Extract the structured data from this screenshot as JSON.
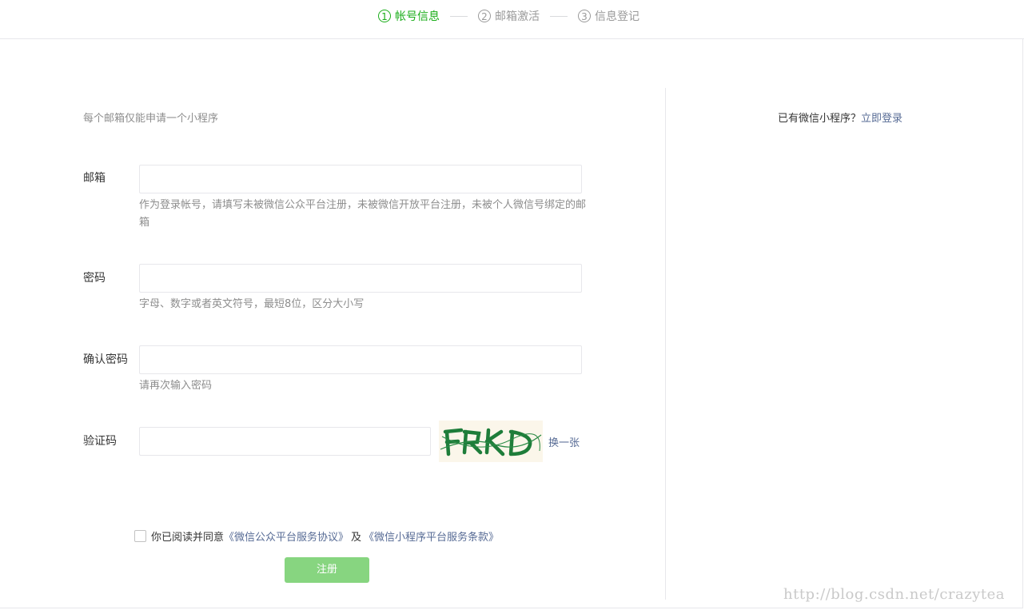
{
  "steps": [
    {
      "num": "1",
      "label": "帐号信息",
      "active": true
    },
    {
      "num": "2",
      "label": "邮箱激活",
      "active": false
    },
    {
      "num": "3",
      "label": "信息登记",
      "active": false
    }
  ],
  "form": {
    "tips": "每个邮箱仅能申请一个小程序",
    "email": {
      "label": "邮箱",
      "value": "",
      "hint": "作为登录帐号，请填写未被微信公众平台注册，未被微信开放平台注册，未被个人微信号绑定的邮箱"
    },
    "password": {
      "label": "密码",
      "value": "",
      "hint": "字母、数字或者英文符号，最短8位，区分大小写"
    },
    "confirm_password": {
      "label": "确认密码",
      "value": "",
      "hint": "请再次输入密码"
    },
    "captcha": {
      "label": "验证码",
      "value": "",
      "refresh_label": "换一张"
    },
    "agreement": {
      "checked": false,
      "prefix": "你已阅读并同意",
      "link1": "《微信公众平台服务协议》",
      "mid": "及",
      "link2": "《微信小程序平台服务条款》"
    },
    "submit_label": "注册"
  },
  "side": {
    "question": "已有微信小程序？",
    "login_link": "立即登录"
  },
  "watermark": "http://blog.csdn.net/crazytea",
  "colors": {
    "accent": "#1aad19",
    "link": "#576b95",
    "button_disabled": "#87d580"
  }
}
